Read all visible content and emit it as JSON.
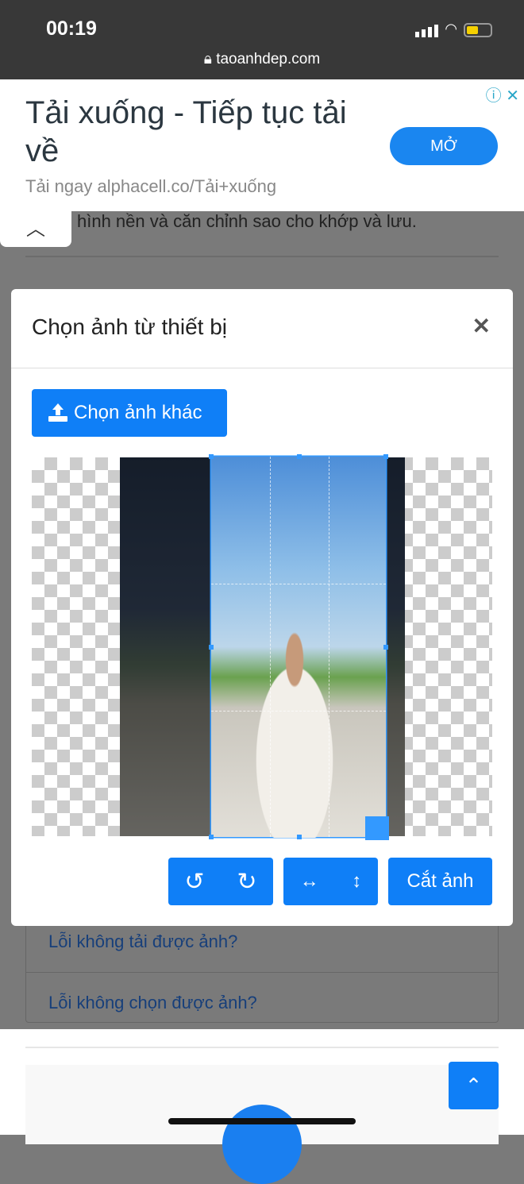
{
  "status": {
    "time": "00:19",
    "url": "taoanhdep.com"
  },
  "ad": {
    "headline": "Tải xuống - Tiếp tục tải về",
    "subtitle": "Tải ngay alphacell.co/Tải+xuống",
    "open_label": "MỞ"
  },
  "background": {
    "text": "hình nền và căn chỉnh sao cho khớp và lưu.",
    "faq": [
      "Lỗi không tải được ảnh?",
      "Lỗi không chọn được ảnh?"
    ]
  },
  "modal": {
    "title": "Chọn ảnh từ thiết bị",
    "choose_label": "Chọn ảnh khác",
    "crop_label": "Cắt ảnh"
  },
  "colors": {
    "primary": "#0f7ff7",
    "cropper": "#3399ff"
  }
}
